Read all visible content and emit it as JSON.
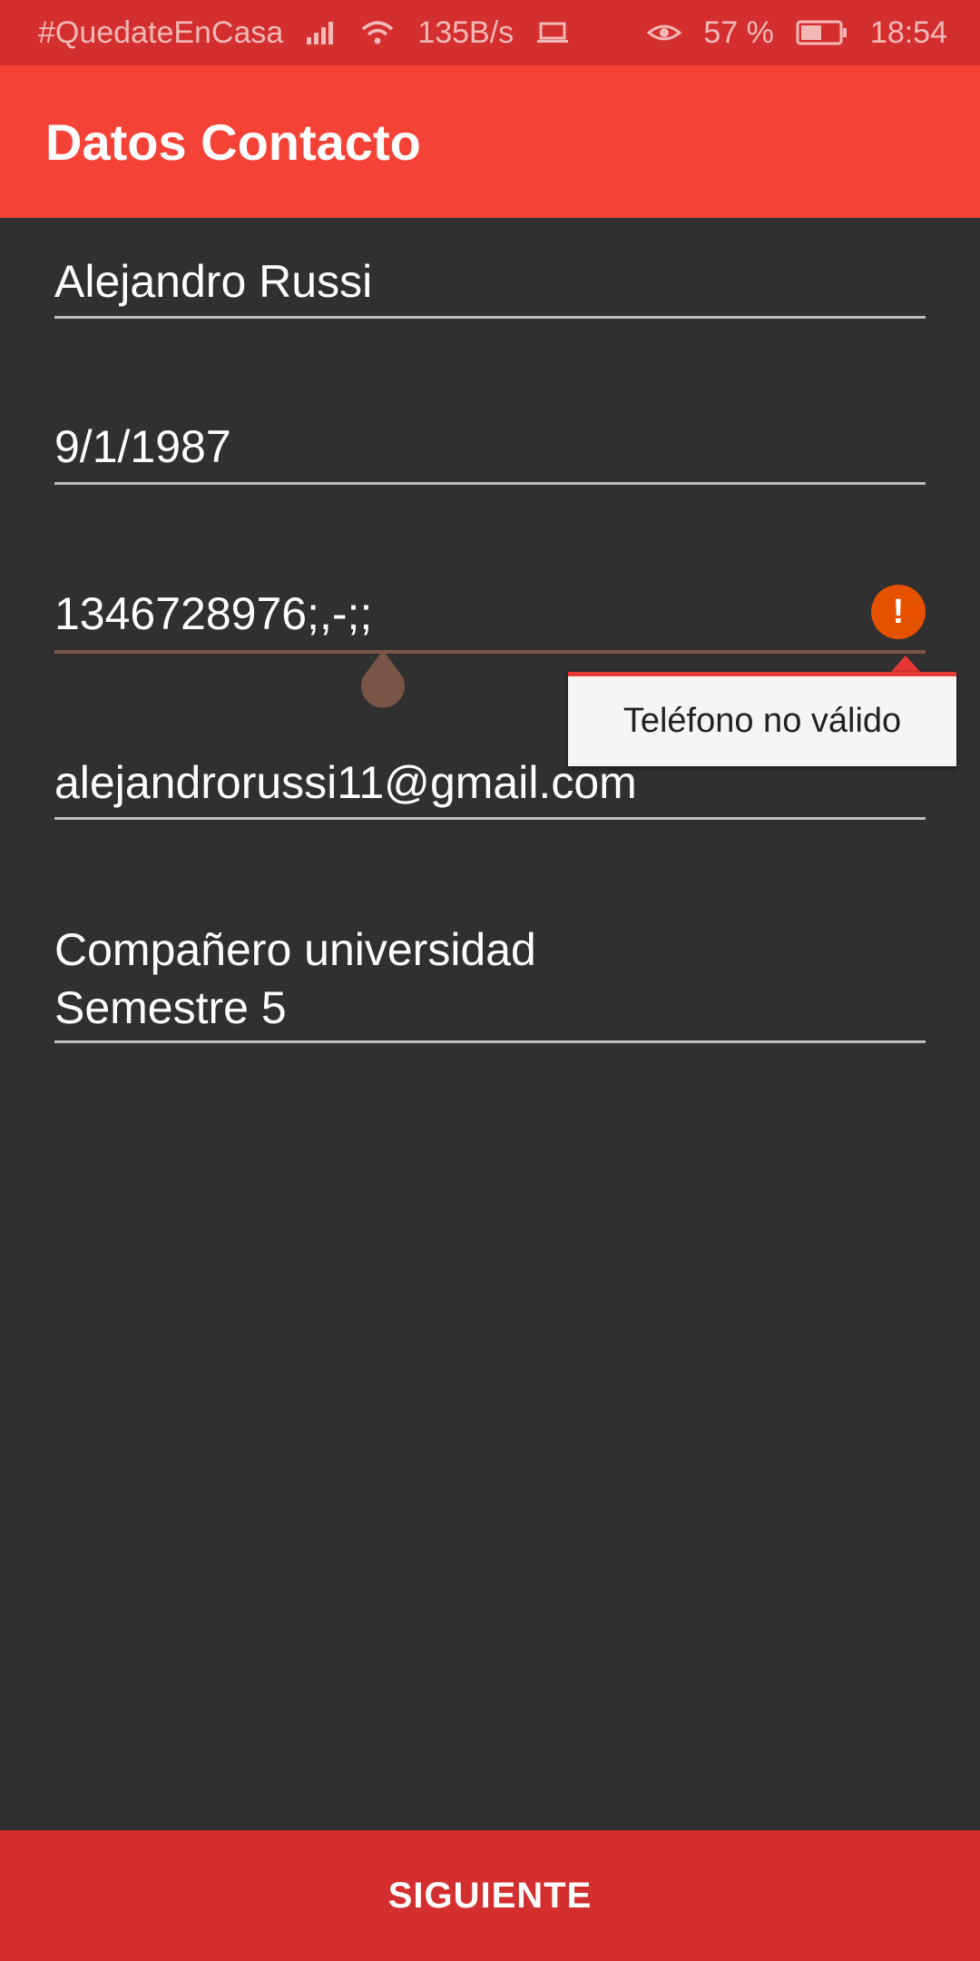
{
  "status_bar": {
    "carrier_text": "#QuedateEnCasa",
    "speed": "135B/s",
    "battery_percent": "57 %",
    "time": "18:54",
    "icons": [
      "signal-icon",
      "wifi-icon",
      "laptop-icon",
      "eye-icon",
      "battery-icon"
    ]
  },
  "app_bar": {
    "title": "Datos Contacto",
    "color": "#f44336"
  },
  "form": {
    "name": "Alejandro Russi",
    "birthdate": "9/1/1987",
    "phone": "1346728976;,-;;",
    "email": "alejandrorussi11@gmail.com",
    "description": "Compañero universidad\nSemestre 5"
  },
  "error": {
    "message": "Teléfono no válido",
    "icon_label": "!"
  },
  "footer": {
    "next_label": "SIGUIENTE",
    "color": "#d32f2f"
  }
}
